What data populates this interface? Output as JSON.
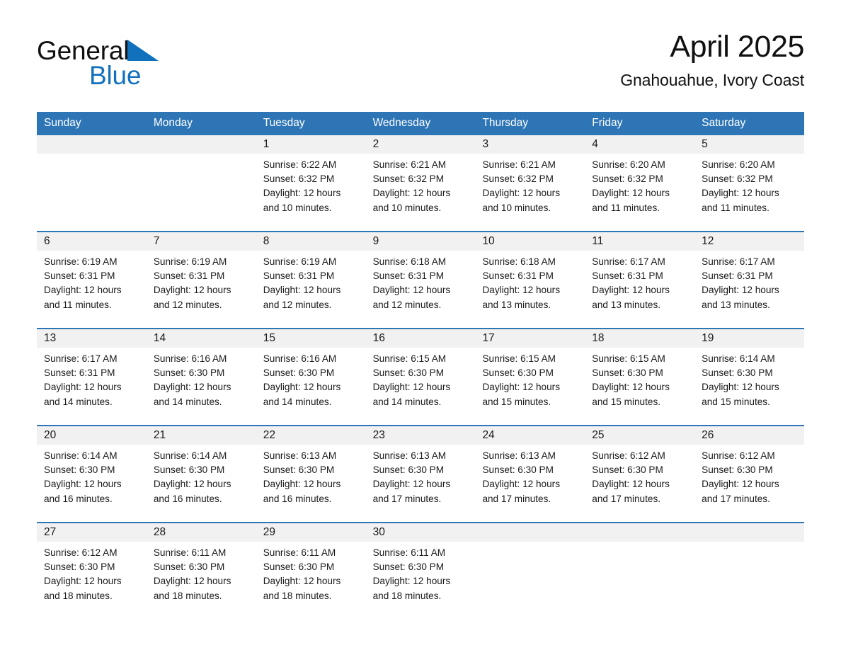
{
  "brand": {
    "name_part1": "General",
    "name_part2": "Blue",
    "triangle_color": "#1271bd",
    "text_color": "#111111"
  },
  "header": {
    "month_title": "April 2025",
    "location": "Gnahouahue, Ivory Coast"
  },
  "theme": {
    "header_blue": "#2e75b6",
    "row_rule_blue": "#2e75b6",
    "daynum_band": "#f1f1f1",
    "cell_background": "#ffffff",
    "text": "#1a1a1a"
  },
  "calendar": {
    "weekdays": [
      "Sunday",
      "Monday",
      "Tuesday",
      "Wednesday",
      "Thursday",
      "Friday",
      "Saturday"
    ],
    "weeks": [
      [
        {
          "day": "",
          "lines": []
        },
        {
          "day": "",
          "lines": []
        },
        {
          "day": "1",
          "lines": [
            "Sunrise: 6:22 AM",
            "Sunset: 6:32 PM",
            "Daylight: 12 hours",
            "and 10 minutes."
          ]
        },
        {
          "day": "2",
          "lines": [
            "Sunrise: 6:21 AM",
            "Sunset: 6:32 PM",
            "Daylight: 12 hours",
            "and 10 minutes."
          ]
        },
        {
          "day": "3",
          "lines": [
            "Sunrise: 6:21 AM",
            "Sunset: 6:32 PM",
            "Daylight: 12 hours",
            "and 10 minutes."
          ]
        },
        {
          "day": "4",
          "lines": [
            "Sunrise: 6:20 AM",
            "Sunset: 6:32 PM",
            "Daylight: 12 hours",
            "and 11 minutes."
          ]
        },
        {
          "day": "5",
          "lines": [
            "Sunrise: 6:20 AM",
            "Sunset: 6:32 PM",
            "Daylight: 12 hours",
            "and 11 minutes."
          ]
        }
      ],
      [
        {
          "day": "6",
          "lines": [
            "Sunrise: 6:19 AM",
            "Sunset: 6:31 PM",
            "Daylight: 12 hours",
            "and 11 minutes."
          ]
        },
        {
          "day": "7",
          "lines": [
            "Sunrise: 6:19 AM",
            "Sunset: 6:31 PM",
            "Daylight: 12 hours",
            "and 12 minutes."
          ]
        },
        {
          "day": "8",
          "lines": [
            "Sunrise: 6:19 AM",
            "Sunset: 6:31 PM",
            "Daylight: 12 hours",
            "and 12 minutes."
          ]
        },
        {
          "day": "9",
          "lines": [
            "Sunrise: 6:18 AM",
            "Sunset: 6:31 PM",
            "Daylight: 12 hours",
            "and 12 minutes."
          ]
        },
        {
          "day": "10",
          "lines": [
            "Sunrise: 6:18 AM",
            "Sunset: 6:31 PM",
            "Daylight: 12 hours",
            "and 13 minutes."
          ]
        },
        {
          "day": "11",
          "lines": [
            "Sunrise: 6:17 AM",
            "Sunset: 6:31 PM",
            "Daylight: 12 hours",
            "and 13 minutes."
          ]
        },
        {
          "day": "12",
          "lines": [
            "Sunrise: 6:17 AM",
            "Sunset: 6:31 PM",
            "Daylight: 12 hours",
            "and 13 minutes."
          ]
        }
      ],
      [
        {
          "day": "13",
          "lines": [
            "Sunrise: 6:17 AM",
            "Sunset: 6:31 PM",
            "Daylight: 12 hours",
            "and 14 minutes."
          ]
        },
        {
          "day": "14",
          "lines": [
            "Sunrise: 6:16 AM",
            "Sunset: 6:30 PM",
            "Daylight: 12 hours",
            "and 14 minutes."
          ]
        },
        {
          "day": "15",
          "lines": [
            "Sunrise: 6:16 AM",
            "Sunset: 6:30 PM",
            "Daylight: 12 hours",
            "and 14 minutes."
          ]
        },
        {
          "day": "16",
          "lines": [
            "Sunrise: 6:15 AM",
            "Sunset: 6:30 PM",
            "Daylight: 12 hours",
            "and 14 minutes."
          ]
        },
        {
          "day": "17",
          "lines": [
            "Sunrise: 6:15 AM",
            "Sunset: 6:30 PM",
            "Daylight: 12 hours",
            "and 15 minutes."
          ]
        },
        {
          "day": "18",
          "lines": [
            "Sunrise: 6:15 AM",
            "Sunset: 6:30 PM",
            "Daylight: 12 hours",
            "and 15 minutes."
          ]
        },
        {
          "day": "19",
          "lines": [
            "Sunrise: 6:14 AM",
            "Sunset: 6:30 PM",
            "Daylight: 12 hours",
            "and 15 minutes."
          ]
        }
      ],
      [
        {
          "day": "20",
          "lines": [
            "Sunrise: 6:14 AM",
            "Sunset: 6:30 PM",
            "Daylight: 12 hours",
            "and 16 minutes."
          ]
        },
        {
          "day": "21",
          "lines": [
            "Sunrise: 6:14 AM",
            "Sunset: 6:30 PM",
            "Daylight: 12 hours",
            "and 16 minutes."
          ]
        },
        {
          "day": "22",
          "lines": [
            "Sunrise: 6:13 AM",
            "Sunset: 6:30 PM",
            "Daylight: 12 hours",
            "and 16 minutes."
          ]
        },
        {
          "day": "23",
          "lines": [
            "Sunrise: 6:13 AM",
            "Sunset: 6:30 PM",
            "Daylight: 12 hours",
            "and 17 minutes."
          ]
        },
        {
          "day": "24",
          "lines": [
            "Sunrise: 6:13 AM",
            "Sunset: 6:30 PM",
            "Daylight: 12 hours",
            "and 17 minutes."
          ]
        },
        {
          "day": "25",
          "lines": [
            "Sunrise: 6:12 AM",
            "Sunset: 6:30 PM",
            "Daylight: 12 hours",
            "and 17 minutes."
          ]
        },
        {
          "day": "26",
          "lines": [
            "Sunrise: 6:12 AM",
            "Sunset: 6:30 PM",
            "Daylight: 12 hours",
            "and 17 minutes."
          ]
        }
      ],
      [
        {
          "day": "27",
          "lines": [
            "Sunrise: 6:12 AM",
            "Sunset: 6:30 PM",
            "Daylight: 12 hours",
            "and 18 minutes."
          ]
        },
        {
          "day": "28",
          "lines": [
            "Sunrise: 6:11 AM",
            "Sunset: 6:30 PM",
            "Daylight: 12 hours",
            "and 18 minutes."
          ]
        },
        {
          "day": "29",
          "lines": [
            "Sunrise: 6:11 AM",
            "Sunset: 6:30 PM",
            "Daylight: 12 hours",
            "and 18 minutes."
          ]
        },
        {
          "day": "30",
          "lines": [
            "Sunrise: 6:11 AM",
            "Sunset: 6:30 PM",
            "Daylight: 12 hours",
            "and 18 minutes."
          ]
        },
        {
          "day": "",
          "lines": []
        },
        {
          "day": "",
          "lines": []
        },
        {
          "day": "",
          "lines": []
        }
      ]
    ]
  }
}
